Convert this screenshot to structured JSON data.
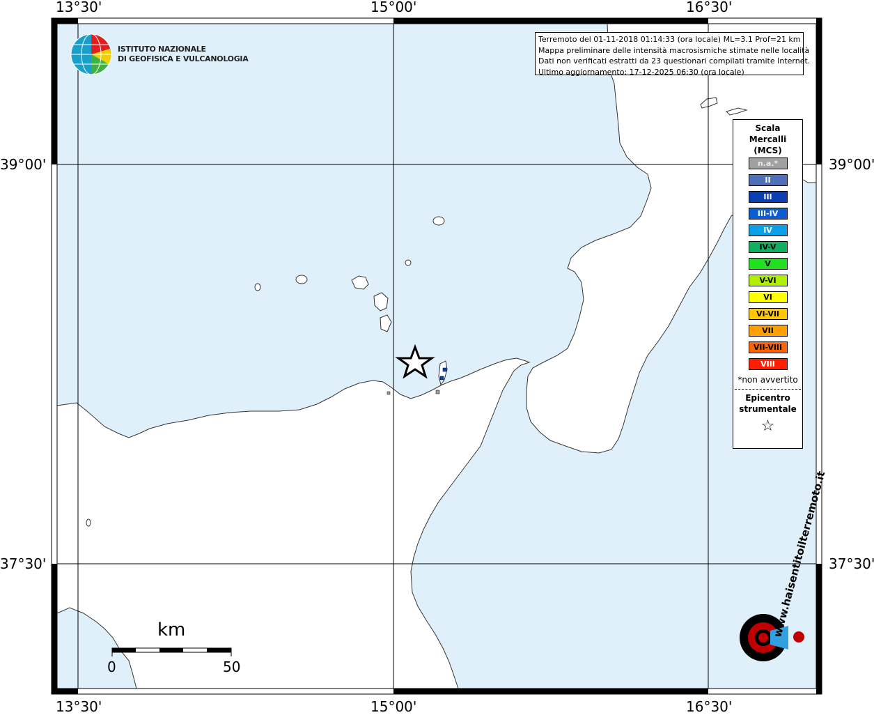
{
  "map": {
    "colors": {
      "sea": "#dff0fb",
      "land": "#ffffff",
      "coast": "#333333",
      "grid": "#000000",
      "frame": "#000000"
    },
    "coordinates": {
      "top": [
        "13°30'",
        "15°00'",
        "16°30'"
      ],
      "bottom": [
        "13°30'",
        "15°00'",
        "16°30'"
      ],
      "left": [
        "39°00'",
        "37°30'"
      ],
      "right": [
        "39°00'",
        "37°30'"
      ]
    }
  },
  "institute": {
    "name_line1": "ISTITUTO NAZIONALE",
    "name_line2": "DI GEOFISICA E VULCANOLOGIA",
    "logo_icon": "ingv-globe-icon"
  },
  "info": {
    "line1": "Terremoto del 01-11-2018 01:14:33 (ora locale) ML=3.1 Prof=21 km",
    "line2": "Mappa preliminare delle intensità macrosismiche stimate nelle località",
    "line3": "Dati non verificati estratti da 23 questionari compilati tramite Internet.",
    "line4": "Ultimo aggiornamento: 17-12-2025 06:30 (ora locale)"
  },
  "legend": {
    "title_line1": "Scala",
    "title_line2": "Mercalli",
    "title_line3": "(MCS)",
    "items": [
      {
        "label": "n.a.*",
        "color": "#a0a0a0",
        "text_color": "#e8e8e8"
      },
      {
        "label": "II",
        "color": "#4f6fb8",
        "text_color": "#ffffff"
      },
      {
        "label": "III",
        "color": "#0a3fb0",
        "text_color": "#ffffff"
      },
      {
        "label": "III-IV",
        "color": "#0a5ed0",
        "text_color": "#ffffff"
      },
      {
        "label": "IV",
        "color": "#0aa0e8",
        "text_color": "#ffffff"
      },
      {
        "label": "IV-V",
        "color": "#10b060",
        "text_color": "#000000"
      },
      {
        "label": "V",
        "color": "#20e020",
        "text_color": "#000000"
      },
      {
        "label": "V-VI",
        "color": "#b0f000",
        "text_color": "#000000"
      },
      {
        "label": "VI",
        "color": "#ffff00",
        "text_color": "#000000"
      },
      {
        "label": "VI-VII",
        "color": "#ffc800",
        "text_color": "#000000"
      },
      {
        "label": "VII",
        "color": "#ffa000",
        "text_color": "#000000"
      },
      {
        "label": "VII-VIII",
        "color": "#ff6400",
        "text_color": "#000000"
      },
      {
        "label": "VIII",
        "color": "#ff1e00",
        "text_color": "#ffffff"
      }
    ],
    "note": "*non avvertito",
    "epicenter_line1": "Epicentro",
    "epicenter_line2": "strumentale",
    "epicenter_symbol": "☆"
  },
  "scale_bar": {
    "title": "km",
    "start": "0",
    "end": "50"
  },
  "hsit_logo": {
    "text": "www.haisentitoilterremoto.it",
    "icon": "hsit-speaker-icon"
  }
}
